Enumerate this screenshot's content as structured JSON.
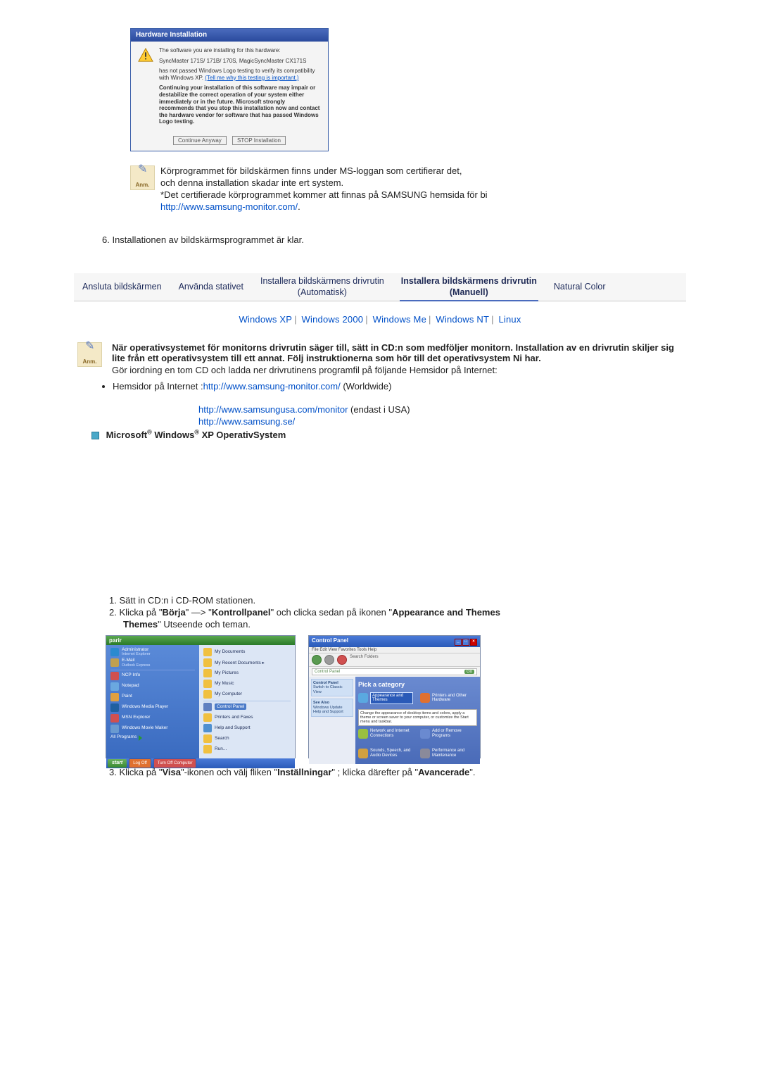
{
  "dialog": {
    "title": "Hardware Installation",
    "line1": "The software you are installing for this hardware:",
    "device": "SyncMaster 171S/ 171B/ 170S, MagicSyncMaster CX171S",
    "line2a": "has not passed Windows Logo testing to verify its compatibility with Windows XP. ",
    "line2_link": "(Tell me why this testing is important.)",
    "para": "Continuing your installation of this software may impair or destabilize the correct operation of your system either immediately or in the future. Microsoft strongly recommends that you stop this installation now and contact the hardware vendor for software that has passed Windows Logo testing.",
    "btn_continue": "Continue Anyway",
    "btn_stop": "STOP Installation"
  },
  "anm_label": "Anm.",
  "anm1": {
    "l1": "Körprogrammet för bildskärmen finns under MS-loggan som certifierar det,",
    "l2": "och denna installation skadar inte ert system.",
    "l3": "*Det certifierade körprogrammet kommer att finnas på SAMSUNG hemsida för bi",
    "link": "http://www.samsung-monitor.com/"
  },
  "step6": "6.   Installationen av bildskärmsprogrammet är klar.",
  "tabs": {
    "t1": "Ansluta bildskärmen",
    "t2": "Använda stativet",
    "t3a": "Installera bildskärmens drivrutin",
    "t3b": "(Automatisk)",
    "t4a": "Installera bildskärmens drivrutin",
    "t4b": "(Manuell)",
    "t5": "Natural Color"
  },
  "oslinks": {
    "xp": "Windows XP",
    "w2k": "Windows 2000",
    "me": "Windows Me",
    "nt": "Windows NT",
    "linux": "Linux"
  },
  "anm2": {
    "b1": "När operativsystemet för monitorns drivrutin säger till, sätt in CD:n som medföljer monitorn. Installation av en drivrutin skiljer sig lite från ett operativsystem till ett annat. Följ instruktionerna som hör till det operativsystem Ni har.",
    "p1": "Gör iordning en tom CD och ladda ner drivrutinens programfil på följande Hemsidor på Internet:"
  },
  "hemsidor_prefix": "Hemsidor på Internet :",
  "link1": "http://www.samsung-monitor.com/",
  "link1_suffix": " (Worldwide)",
  "link2": "http://www.samsungusa.com/monitor",
  "link2_suffix": " (endast i USA)",
  "link3": "http://www.samsung.se/",
  "section_heading": "Microsoft® Windows® XP OperativSystem",
  "steps": {
    "s1": "1.   Sätt in CD:n i CD-ROM stationen.",
    "s2a": "2.   Klicka på \"",
    "s2_borja": "Börja",
    "s2b": "\" —> \"",
    "s2_kontroll": "Kontrollpanel",
    "s2c": "\" och clicka sedan på ikonen \"",
    "s2_app": "Appearance and Themes",
    "s2d": "\" Utseende och teman."
  },
  "xpmenu": {
    "title": "parir",
    "user": "Administrator",
    "user_sub": "Internet Explorer",
    "email": "E-Mail",
    "email_sub": "Outlook Express",
    "items_left": [
      "NCP Info",
      "Notepad",
      "Paint",
      "Windows Media Player",
      "MSN Explorer",
      "Windows Movie Maker"
    ],
    "all": "All Programs",
    "right": [
      "My Documents",
      "My Recent Documents",
      "My Pictures",
      "My Music",
      "My Computer"
    ],
    "right2_hl": "Control Panel",
    "right2": [
      "Printers and Faxes",
      "Help and Support",
      "Search",
      "Run..."
    ],
    "start": "start",
    "task1": "Log Off",
    "task2": "Turn Off Computer"
  },
  "cp": {
    "title": "Control Panel",
    "menu": "File  Edit  View  Favorites  Tools  Help",
    "addr": "Control Panel",
    "go": "Go",
    "side_title": "Control Panel",
    "side_item": "Switch to Classic View",
    "see_also": "See Also",
    "see1": "Windows Update",
    "see2": "Help and Support",
    "pick": "Pick a category",
    "cat_hl": "Appearance and Themes",
    "cats": [
      "Printers and Other Hardware",
      "Network and Internet Connections",
      "Add or Remove Programs",
      "Sounds, Speech, and Audio Devices",
      "Performance and Maintenance",
      "",
      ""
    ],
    "tip": "Change the appearance of desktop items and colors, apply a theme or screen saver to your computer, or customize the Start menu and taskbar."
  },
  "step3": {
    "pre": "3.   Klicka på \"",
    "visa": "Visa",
    "mid1": "\"-ikonen och välj fliken \"",
    "inst": "Inställningar",
    "mid2": "\" ; klicka därefter på \"",
    "adv": "Avancerade",
    "post": "\"."
  }
}
